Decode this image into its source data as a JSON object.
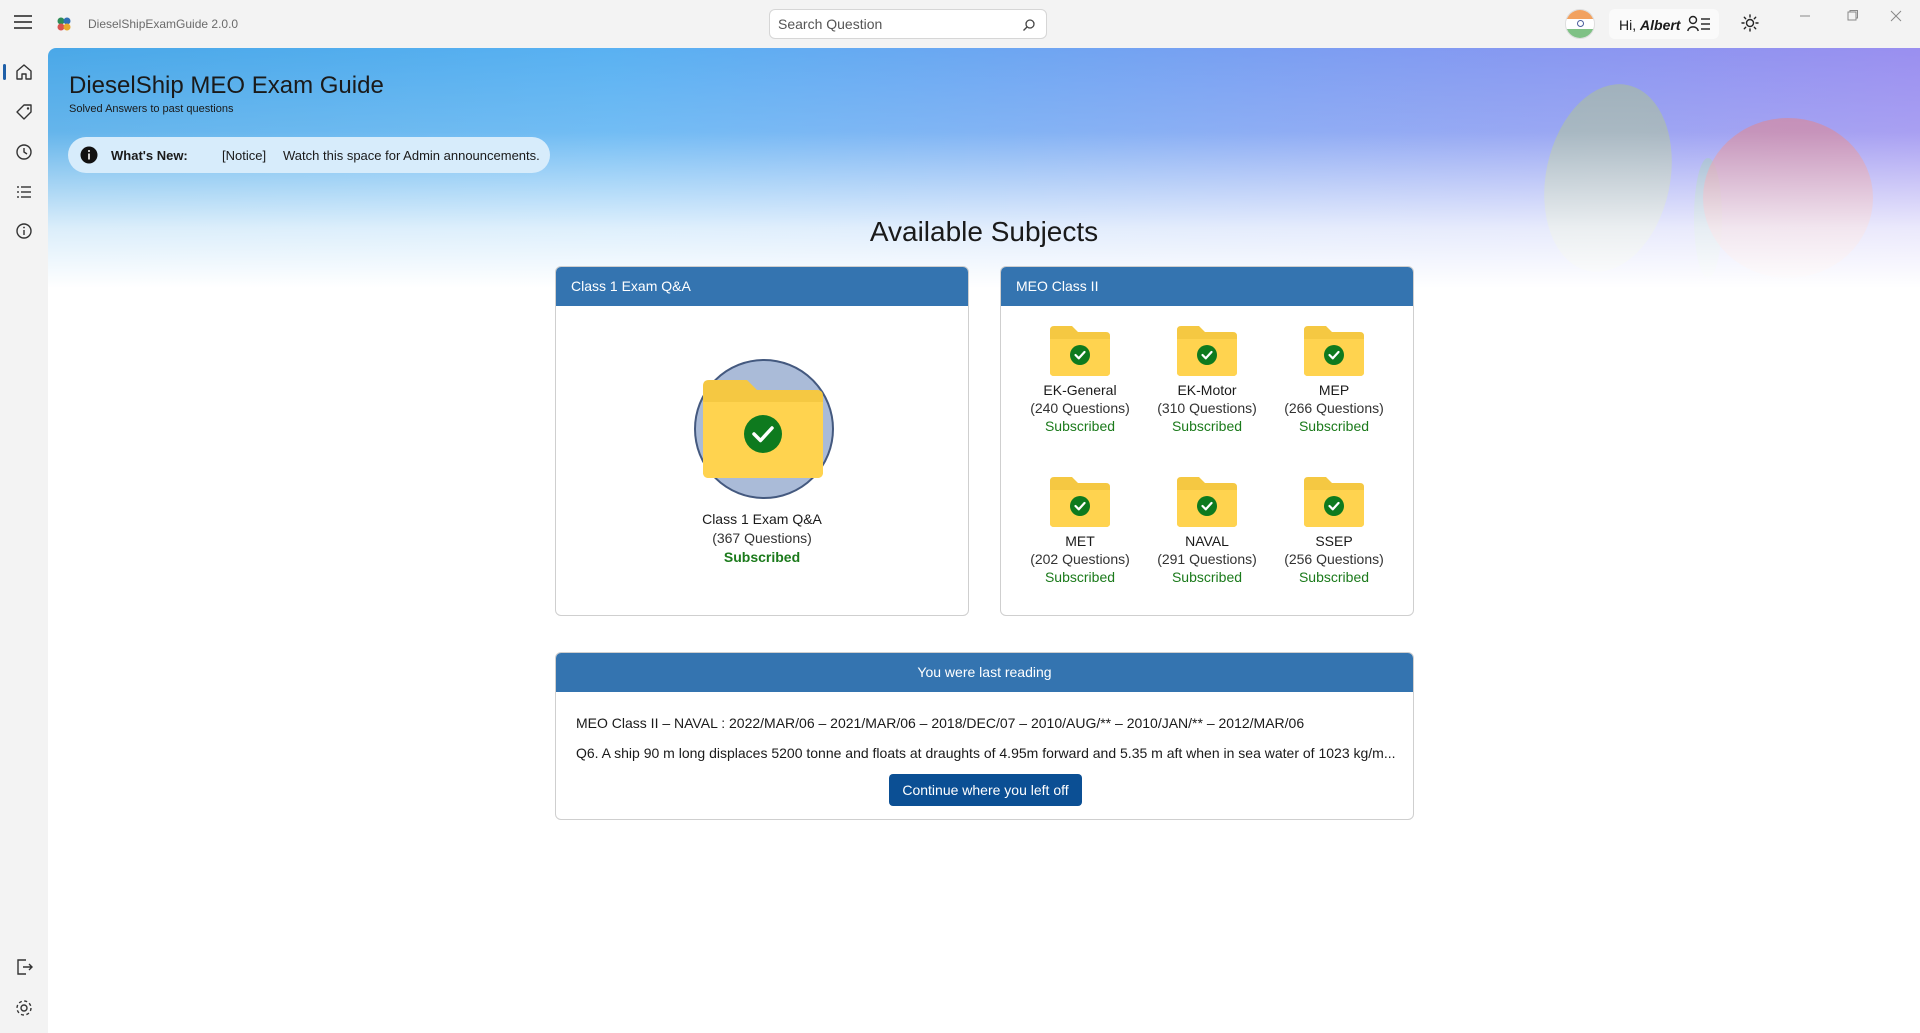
{
  "app": {
    "title": "DieselShipExamGuide 2.0.0",
    "accent": "#3474b0",
    "button_color": "#0b4f94",
    "success_color": "#1b7a1b"
  },
  "search": {
    "placeholder": "Search Question",
    "icon": "search-icon"
  },
  "user": {
    "greeting": "Hi,",
    "name": "Albert"
  },
  "sidebar": {
    "top_items": [
      {
        "icon": "home-icon",
        "active": true
      },
      {
        "icon": "tag-icon",
        "active": false
      },
      {
        "icon": "clock-icon",
        "active": false
      },
      {
        "icon": "list-icon",
        "active": false
      },
      {
        "icon": "info-icon",
        "active": false
      }
    ],
    "bottom_items": [
      {
        "icon": "logout-icon"
      },
      {
        "icon": "settings-icon"
      }
    ]
  },
  "header": {
    "title": "DieselShip MEO Exam Guide",
    "subtitle": "Solved Answers to past questions"
  },
  "whats_new": {
    "label": "What's New:",
    "tag": "[Notice]",
    "text": "Watch this space for Admin announcements."
  },
  "subjects_section": {
    "title": "Available Subjects"
  },
  "class1_card": {
    "header": "Class 1 Exam Q&A",
    "item": {
      "name": "Class 1 Exam Q&A",
      "count": "(367 Questions)",
      "status": "Subscribed"
    }
  },
  "meo2_card": {
    "header": "MEO Class II",
    "items": [
      {
        "name": "EK-General",
        "count": "(240 Questions)",
        "status": "Subscribed"
      },
      {
        "name": "EK-Motor",
        "count": "(310 Questions)",
        "status": "Subscribed"
      },
      {
        "name": "MEP",
        "count": "(266 Questions)",
        "status": "Subscribed"
      },
      {
        "name": "MET",
        "count": "(202 Questions)",
        "status": "Subscribed"
      },
      {
        "name": "NAVAL",
        "count": "(291 Questions)",
        "status": "Subscribed"
      },
      {
        "name": "SSEP",
        "count": "(256 Questions)",
        "status": "Subscribed"
      }
    ]
  },
  "last_reading": {
    "header": "You were last reading",
    "path": "MEO Class II – NAVAL : 2022/MAR/06 – 2021/MAR/06 – 2018/DEC/07 – 2010/AUG/** – 2010/JAN/** – 2012/MAR/06",
    "question": "Q6. A ship 90 m long displaces 5200 tonne and floats at draughts of 4.95m forward and 5.35 m aft when in sea water of 1023 kg/m...",
    "button": "Continue where you left off"
  }
}
